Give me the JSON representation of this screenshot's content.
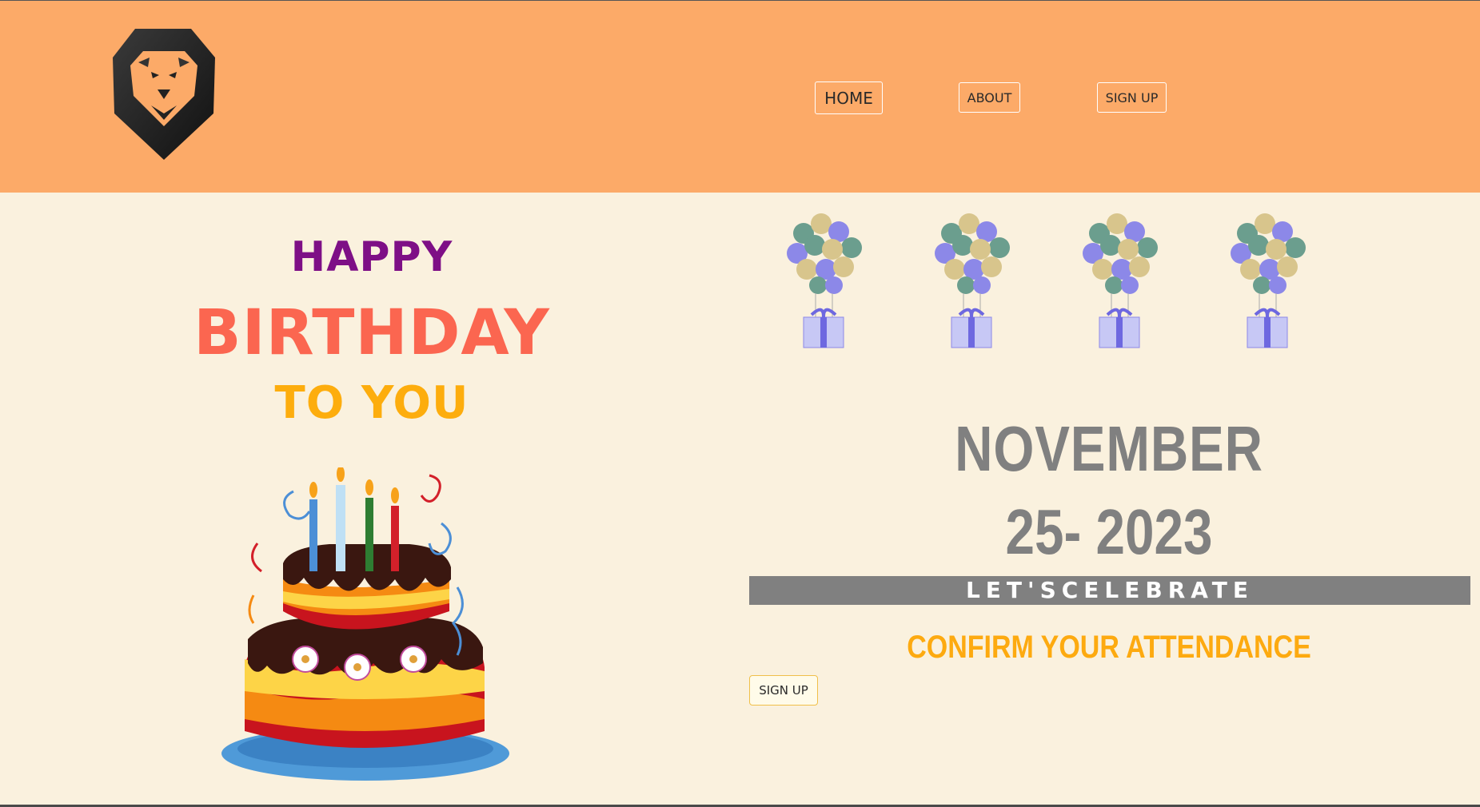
{
  "header": {
    "logo_icon": "lion-head-icon",
    "nav": {
      "home_label": "HOME",
      "about_label": "ABOUT",
      "signup_label": "SIGN UP"
    }
  },
  "greeting": {
    "line1": "HAPPY",
    "line2": "BIRTHDAY",
    "line3": "TO YOU"
  },
  "event": {
    "month": "NOVEMBER",
    "date": "25- 2023",
    "tagline": "LET'SCELEBRATE",
    "confirm_text": "CONFIRM YOUR ATTENDANCE",
    "signup_label": "SIGN UP"
  },
  "images": {
    "cake": "birthday-cake-image",
    "balloon": "balloon-gift-image"
  },
  "colors": {
    "header_bg": "#fcaa68",
    "page_bg": "#faf1de",
    "happy": "#7e0f86",
    "birthday": "#fb6650",
    "to_you": "#fdad0d",
    "date": "#808080",
    "confirm": "#fdaa10"
  }
}
